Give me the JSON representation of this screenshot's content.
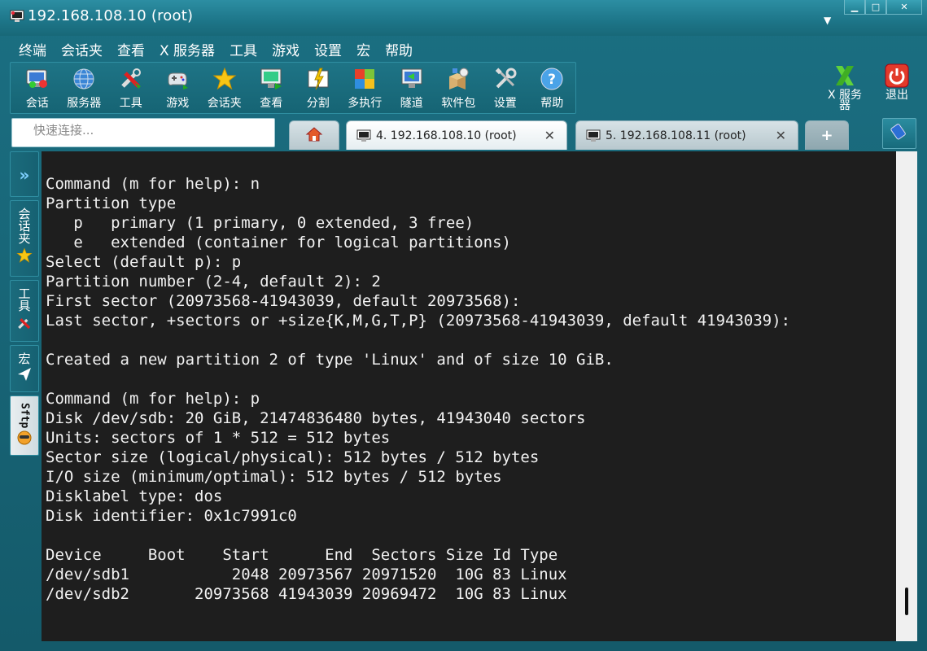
{
  "window": {
    "title": "192.168.108.10 (root)"
  },
  "menu": [
    "终端",
    "会话夹",
    "查看",
    "X 服务器",
    "工具",
    "游戏",
    "设置",
    "宏",
    "帮助"
  ],
  "toolbar": {
    "items": [
      {
        "label": "会话",
        "icon": "session-icon"
      },
      {
        "label": "服务器",
        "icon": "globe-icon"
      },
      {
        "label": "工具",
        "icon": "tools-icon"
      },
      {
        "label": "游戏",
        "icon": "gamepad-icon"
      },
      {
        "label": "会话夹",
        "icon": "star-icon"
      },
      {
        "label": "查看",
        "icon": "monitor-icon"
      },
      {
        "label": "分割",
        "icon": "split-icon"
      },
      {
        "label": "多执行",
        "icon": "multi-exec-icon"
      },
      {
        "label": "隧道",
        "icon": "tunnel-icon"
      },
      {
        "label": "软件包",
        "icon": "packages-icon"
      },
      {
        "label": "设置",
        "icon": "settings-icon"
      },
      {
        "label": "帮助",
        "icon": "help-icon"
      }
    ],
    "xserver_label_1": "X 服务",
    "xserver_label_2": "器",
    "exit_label": "退出"
  },
  "quick_connect": {
    "placeholder": "快速连接..."
  },
  "tabs": [
    {
      "label": "4. 192.168.108.10 (root)",
      "active": true
    },
    {
      "label": "5. 192.168.108.11 (root)",
      "active": false
    }
  ],
  "side_tabs": {
    "sessions": "会话夹",
    "tools": "工具",
    "macros": "宏",
    "sftp": "Sftp"
  },
  "terminal": {
    "lines": [
      "Command (m for help): n",
      "Partition type",
      "   p   primary (1 primary, 0 extended, 3 free)",
      "   e   extended (container for logical partitions)",
      "Select (default p): p",
      "Partition number (2-4, default 2): 2",
      "First sector (20973568-41943039, default 20973568):",
      "Last sector, +sectors or +size{K,M,G,T,P} (20973568-41943039, default 41943039):",
      "",
      "Created a new partition 2 of type 'Linux' and of size 10 GiB.",
      "",
      "Command (m for help): p",
      "Disk /dev/sdb: 20 GiB, 21474836480 bytes, 41943040 sectors",
      "Units: sectors of 1 * 512 = 512 bytes",
      "Sector size (logical/physical): 512 bytes / 512 bytes",
      "I/O size (minimum/optimal): 512 bytes / 512 bytes",
      "Disklabel type: dos",
      "Disk identifier: 0x1c7991c0",
      "",
      "Device     Boot    Start      End  Sectors Size Id Type",
      "/dev/sdb1           2048 20973567 20971520  10G 83 Linux",
      "/dev/sdb2       20973568 41943039 20969472  10G 83 Linux"
    ]
  }
}
